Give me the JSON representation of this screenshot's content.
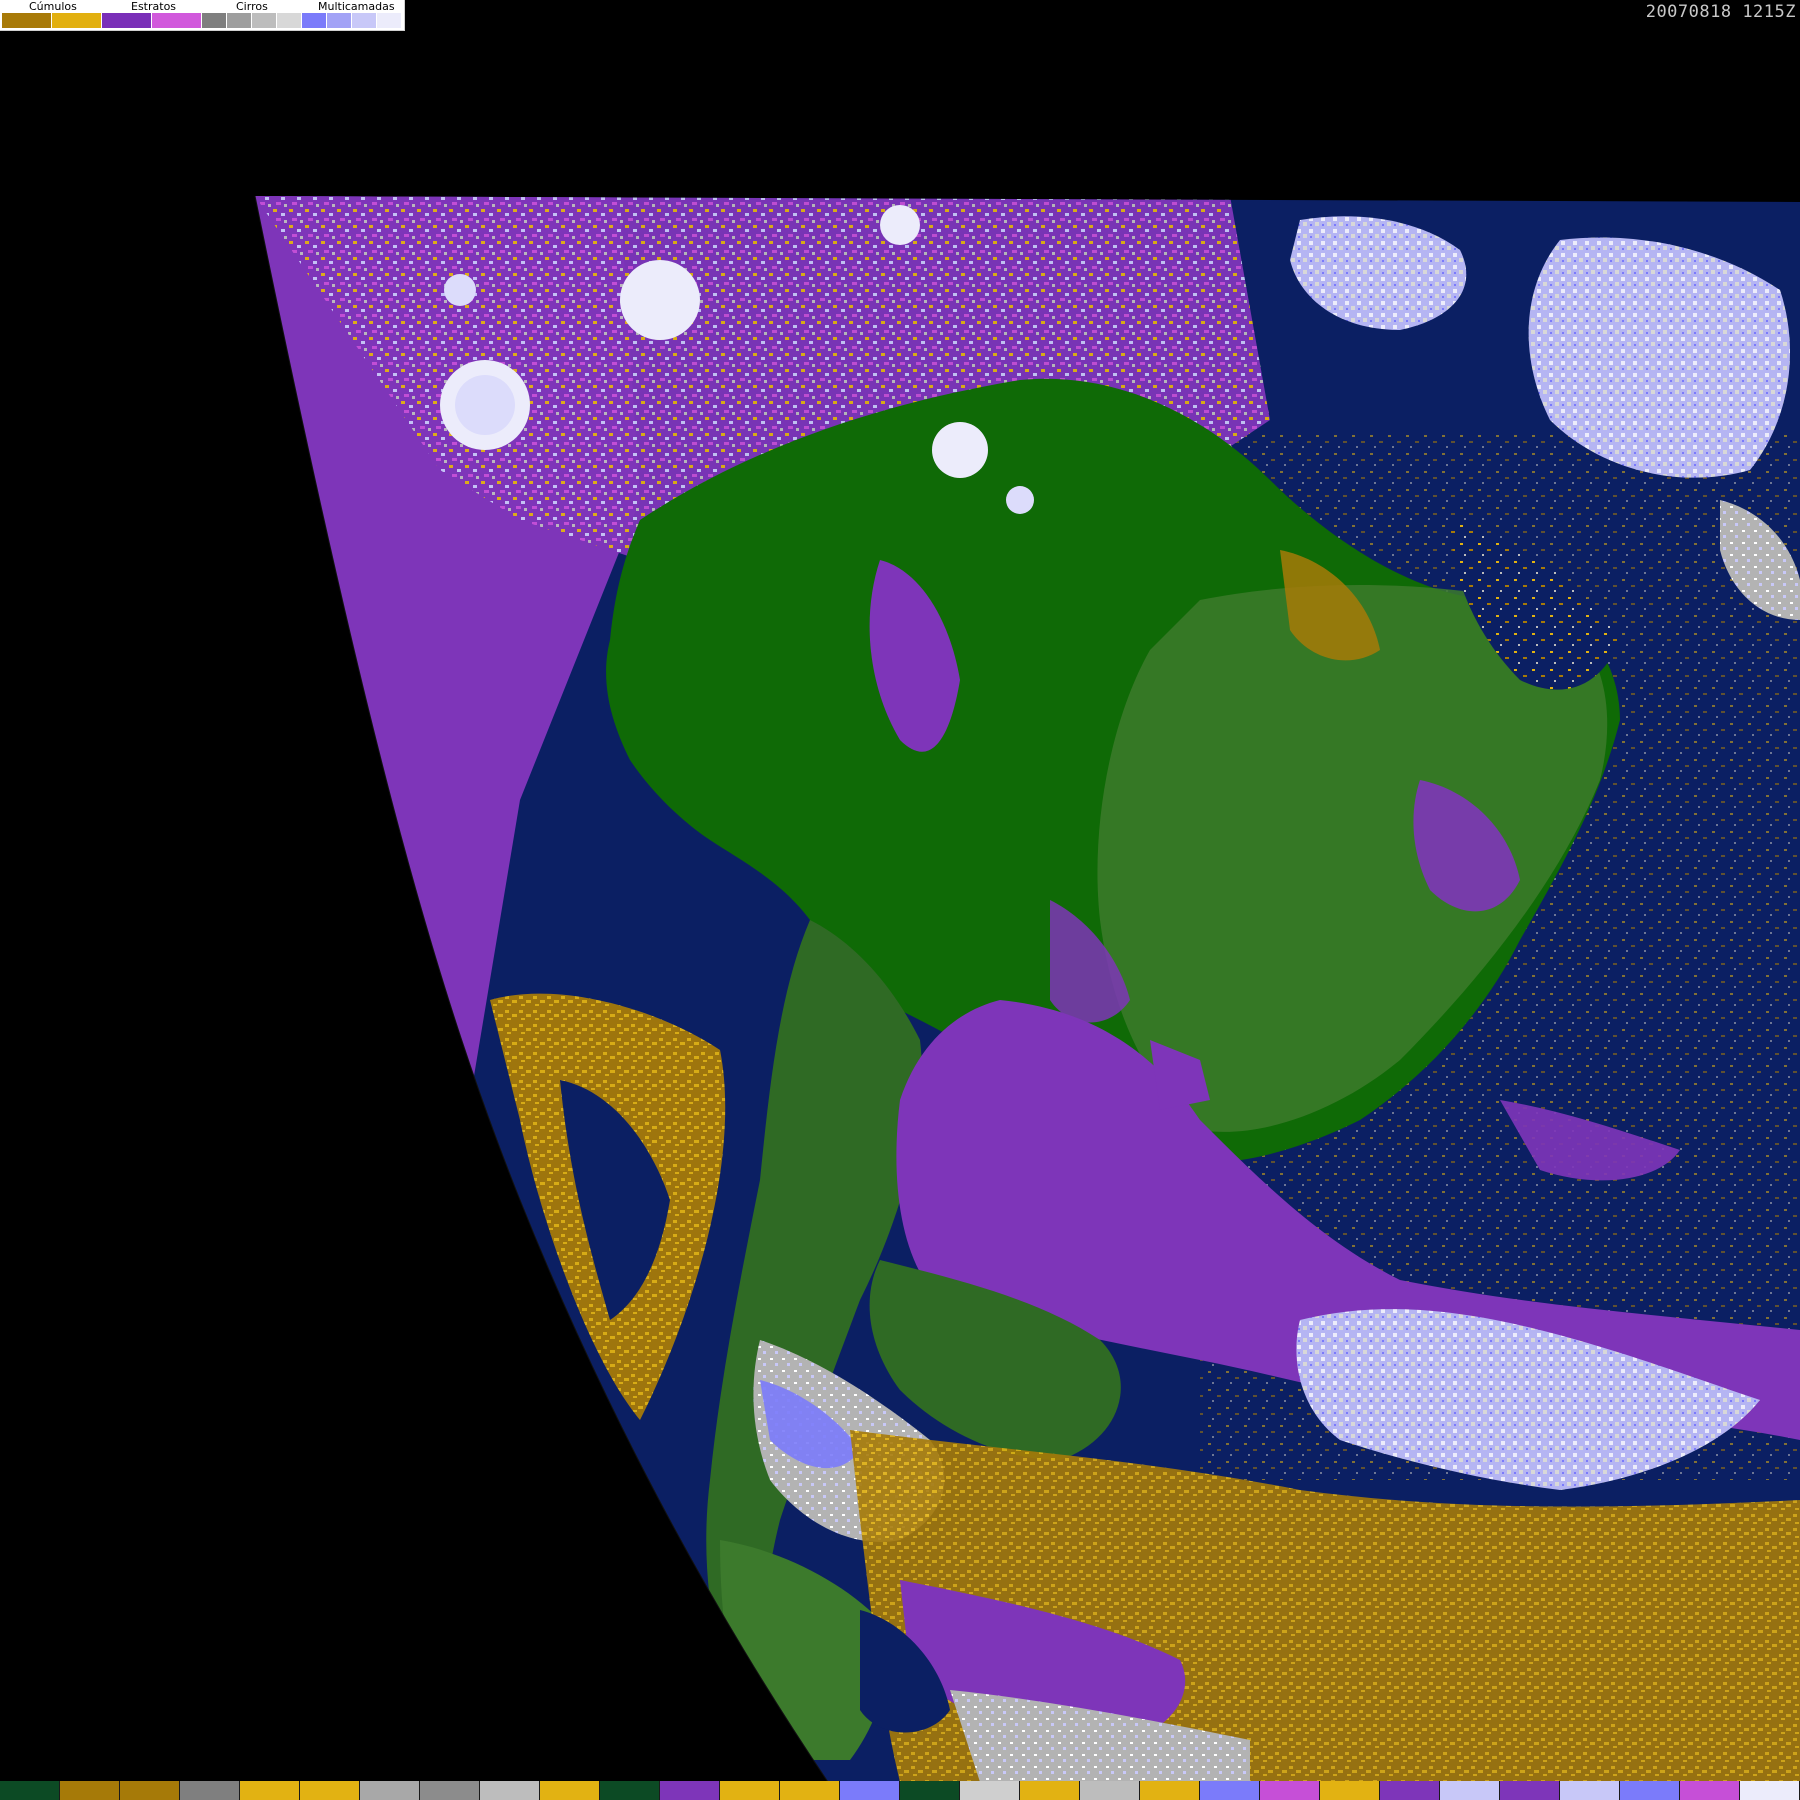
{
  "legend": {
    "groups": [
      {
        "label": "Cúmulos",
        "swatches": [
          "#a87a08",
          "#e2b010"
        ]
      },
      {
        "label": "Estratos",
        "swatches": [
          "#7a2fb8",
          "#d159dc"
        ]
      },
      {
        "label": "Cirros",
        "swatches": [
          "#7f7f7f",
          "#9e9e9e",
          "#bdbdbd",
          "#d8d8d8"
        ]
      },
      {
        "label": "Multicamadas",
        "swatches": [
          "#7b7bfa",
          "#a2a2f6",
          "#c8c8f8",
          "#ececfb"
        ]
      }
    ]
  },
  "timestamp": "20070818 1215Z",
  "map": {
    "colors": {
      "background": "#000000",
      "ocean": "#0b1f63",
      "forest": "#0f6a06",
      "land_light": "#3c7a2c",
      "stratus": "#7e35b9",
      "stratus_light": "#c64fd7",
      "cumulus_dark": "#a67a08",
      "cumulus_light": "#e2b212",
      "cirrus": "#b3b3b3",
      "multilayer": "#b5b5f3",
      "multilayer_bright": "#dcdcfb",
      "multilayer_blue": "#7b7bfa"
    }
  },
  "bottom_strip": {
    "colors": [
      "#0c4a24",
      "#a67a08",
      "#a67a08",
      "#7f7f7f",
      "#e2b212",
      "#e2b212",
      "#a8a8a8",
      "#8c8c8c",
      "#bdbdbd",
      "#e2b212",
      "#0c4a24",
      "#7e35b9",
      "#e2b212",
      "#e2b212",
      "#7b7bfa",
      "#0c4a24",
      "#cfcfcf",
      "#e2b212",
      "#bdbdbd",
      "#e2b212",
      "#7b7bfa",
      "#c64fd7",
      "#e2b212",
      "#7e35b9",
      "#c8c8f8",
      "#7e35b9",
      "#c8c8f8",
      "#7b7bfa",
      "#c64fd7",
      "#ececfb"
    ]
  }
}
